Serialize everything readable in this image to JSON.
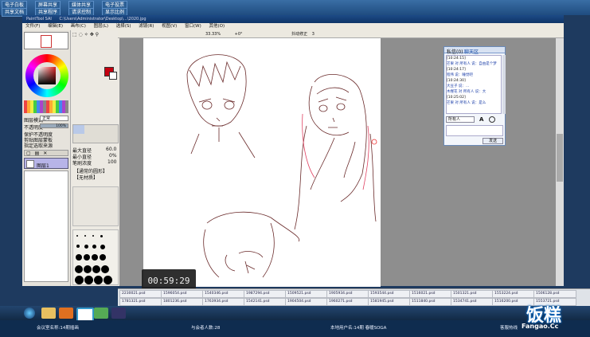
{
  "conference_tabs": [
    "电子白板",
    "屏幕共享",
    "媒体共享",
    "电子投票",
    "共享文档",
    "共享程序",
    "请求控制",
    "显示比例"
  ],
  "sai": {
    "title": "PaintTool SAI",
    "path": "C:\\Users\\Administrator\\Desktop\\...\\2020.jpg",
    "menu": [
      "文件(F)",
      "编辑(E)",
      "画布(C)",
      "图层(L)",
      "选择(S)",
      "滤镜(R)",
      "视图(V)",
      "窗口(W)",
      "其他(O)"
    ],
    "toolbar": {
      "zoom": "33.33%",
      "angle": "+0°",
      "stabilizer_label": "抖动修正",
      "stabilizer_val": "3"
    },
    "left_labels": [
      "图层模式",
      "不透明度",
      "保护不透明度",
      "剪贴图层蒙板",
      "指定选取来源"
    ],
    "blend_mode": "正常",
    "opacity": "100%",
    "layer_name": "图层1",
    "brush_params": {
      "size": "最大直径",
      "size_val": "60.0",
      "min_size": "最小直径",
      "min_val": "0%",
      "density": "笔刷浓度",
      "density_val": "100",
      "shape": "【通常的圆形】",
      "texture": "【无材质】"
    }
  },
  "chat": {
    "tabs": [
      "私信(0)",
      "聊天区"
    ],
    "messages": [
      "[10:24:15]",
      "芒果 对 所有人 说：自由是个梦",
      "[10:24:17]",
      "程伟 说：睡觉吧",
      "[10:24:30]",
      "大豆子 说：...",
      "木槿花 对 所有人 说：大",
      "[10:25:02]",
      "芒果 对 所有人 说：是么"
    ],
    "to_label": "所有人",
    "send": "发送"
  },
  "timer": "00:59:29",
  "strip_rows": [
    [
      "2230021.psd",
      "1596054.psd",
      "1540346.psd",
      "1987294.psd",
      "1509521.psd",
      "1905934.psd",
      "1593544.psd",
      "1516021.psd",
      "1501321.psd",
      "1553224.psd",
      "1506128.psd"
    ],
    [
      "1781321.psd",
      "1801236.psd",
      "1763934.psd",
      "1542141.psd",
      "1904504.psd",
      "1960271.psd",
      "1581945.psd",
      "1511840.psd",
      "1534741.psd",
      "1516200.psd",
      "1553721.psd"
    ]
  ],
  "status": {
    "room": "会议室名称:14期插画",
    "attendees": "与会者人数:28",
    "user": "本地用户名:14期 春暖SOGA",
    "service": "客服热线"
  },
  "watermark": {
    "brand": "饭糕",
    "url": "Fangao.Cc"
  }
}
